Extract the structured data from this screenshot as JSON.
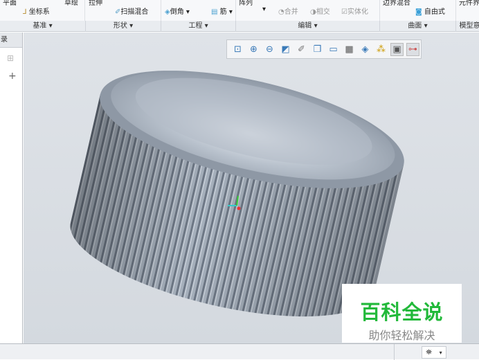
{
  "ribbon": {
    "row1": [
      "平面",
      "草绘",
      "拉伸",
      "阵列",
      "边界混合",
      "元件界"
    ],
    "buttons": {
      "csys": "坐标系",
      "sweep_blend": "扫描混合",
      "chamfer": "倒角 ▾",
      "rib": "筋 ▾",
      "pattern_arrow": "▾",
      "merge": "合并",
      "intersect": "相交",
      "solidify": "实体化",
      "freestyle": "自由式"
    },
    "groups": [
      "基准 ▾",
      "形状 ▾",
      "工程 ▾",
      "编辑 ▾",
      "曲面 ▾",
      "模型意"
    ]
  },
  "left_panel": {
    "tab": "录",
    "plus": "+"
  },
  "view_toolbar": [
    "zoom-fit-icon",
    "zoom-in-icon",
    "zoom-out-icon",
    "repaint-icon",
    "spin-center-icon",
    "view-orientation-icon",
    "saved-views-icon",
    "display-style-icon",
    "perspective-icon",
    "datum-display-icon",
    "annotation-icon",
    "model-tree-toggle-icon"
  ],
  "watermark": {
    "title": "百科全说",
    "subtitle": "助你轻松解决"
  },
  "status": {
    "find_arrow": "▾"
  },
  "colors": {
    "accent": "#22b93a",
    "model": "#a9b3bf"
  }
}
